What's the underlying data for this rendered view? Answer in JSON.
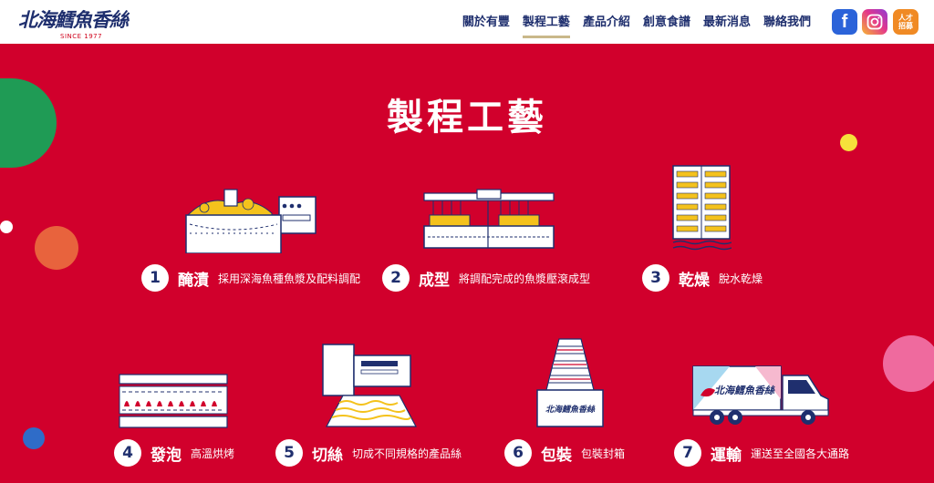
{
  "header": {
    "logo_text": "北海鱈魚香絲",
    "logo_since": "SINCE 1977",
    "nav": [
      {
        "label": "關於有豐",
        "active": false
      },
      {
        "label": "製程工藝",
        "active": true
      },
      {
        "label": "產品介紹",
        "active": false
      },
      {
        "label": "創意食譜",
        "active": false
      },
      {
        "label": "最新消息",
        "active": false
      },
      {
        "label": "聯絡我們",
        "active": false
      }
    ],
    "social": {
      "facebook_icon": "f",
      "instagram_icon": "instagram-icon",
      "recruit_line1": "人才",
      "recruit_line2": "招募"
    }
  },
  "colors": {
    "brand_red": "#d1002c",
    "navy": "#1f2f6e",
    "gold_underline": "#c9b88a"
  },
  "main": {
    "title": "製程工藝",
    "steps": [
      {
        "num": "1",
        "name": "醃漬",
        "desc": "採用深海魚種魚漿及配料調配"
      },
      {
        "num": "2",
        "name": "成型",
        "desc": "將調配完成的魚漿壓滾成型"
      },
      {
        "num": "3",
        "name": "乾燥",
        "desc": "脫水乾燥"
      },
      {
        "num": "4",
        "name": "發泡",
        "desc": "高溫烘烤"
      },
      {
        "num": "5",
        "name": "切絲",
        "desc": "切成不同規格的產品絲"
      },
      {
        "num": "6",
        "name": "包裝",
        "desc": "包裝封箱"
      },
      {
        "num": "7",
        "name": "運輸",
        "desc": "運送至全國各大通路"
      }
    ],
    "truck_logo_text": "北海鱈魚香絲",
    "box_logo_text": "北海鱈魚香絲"
  }
}
